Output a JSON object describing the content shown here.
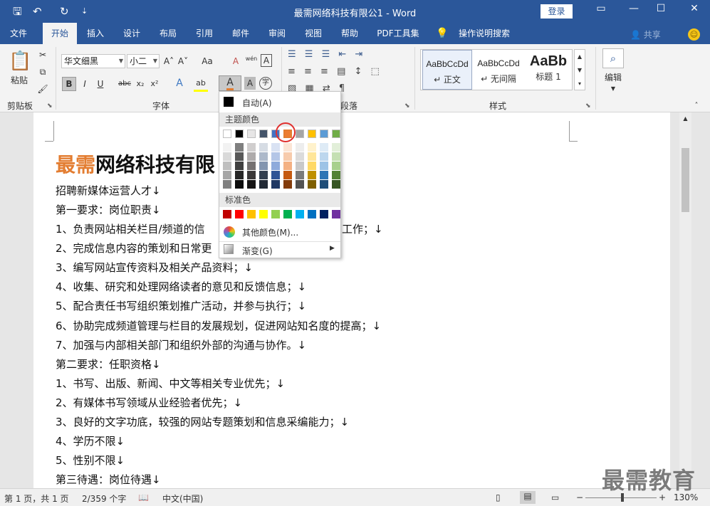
{
  "titlebar": {
    "title": "最需网络科技有限公1 - Word",
    "login": "登录",
    "qat": {
      "save": "🖫",
      "undo": "↶",
      "redo": "↻",
      "more": "⇣"
    },
    "controls": {
      "ribbon": "▭",
      "minimize": "—",
      "maximize": "☐",
      "close": "✕"
    }
  },
  "tabs": [
    "文件",
    "开始",
    "插入",
    "设计",
    "布局",
    "引用",
    "邮件",
    "审阅",
    "视图",
    "帮助",
    "PDF工具集",
    "操作说明搜索"
  ],
  "share": "共享",
  "ribbon": {
    "clipboard": {
      "paste": "粘贴",
      "label": "剪贴板"
    },
    "font": {
      "name": "华文细黑",
      "size": "小二",
      "label": "字体",
      "bold": "B",
      "italic": "I",
      "underline": "U",
      "strike": "abc",
      "sub": "x₂",
      "sup": "x²",
      "grow": "A˄",
      "shrink": "A˅",
      "case": "Aa",
      "clear": "A",
      "phonetic": "wén",
      "border": "A",
      "effect": "A",
      "highlight": "ab",
      "color": "A",
      "shade": "A",
      "circle": "字"
    },
    "paragraph": {
      "label": "段落"
    },
    "styles": {
      "label": "样式",
      "items": [
        {
          "sample": "AaBbCcDd",
          "name": "↵ 正文"
        },
        {
          "sample": "AaBbCcDd",
          "name": "↵ 无间隔"
        },
        {
          "sample": "AaBb",
          "name": "标题 1"
        }
      ]
    },
    "editing": {
      "label": "编辑"
    }
  },
  "document": {
    "title_accent": "最需",
    "title_rest": "网络科技有限",
    "lines": [
      "招聘新媒体运营人才↓",
      "第一要求：岗位职责↓",
      "1、负责网站相关栏目/频道的信",
      "2、完成信息内容的策划和日常更",
      "3、编写网站宣传资料及相关产品资料；↓",
      "4、收集、研究和处理网络读者的意见和反馈信息；↓",
      "5、配合责任书写组织策划推广活动，并参与执行；↓",
      "6、协助完成频道管理与栏目的发展规划，促进网站知名度的提高；↓",
      "7、加强与内部相关部门和组织外部的沟通与协作。↓",
      "第二要求：任职资格↓",
      "1、书写、出版、新闻、中文等相关专业优先；↓",
      "2、有媒体书写领域从业经验者优先；↓",
      "3、良好的文字功底，较强的网站专题策划和信息采编能力；↓",
      "4、学历不限↓",
      "5、性别不限↓",
      "第三待遇：岗位待遇↓"
    ],
    "line1_tail": "工作；↓"
  },
  "font_color_menu": {
    "auto": "自动(A)",
    "theme_label": "主题颜色",
    "standard_label": "标准色",
    "more": "其他颜色(M)...",
    "gradient": "渐变(G)",
    "theme_top": [
      "#ffffff",
      "#000000",
      "#e7e6e6",
      "#44546a",
      "#4472c4",
      "#ed7d31",
      "#a5a5a5",
      "#ffc000",
      "#5b9bd5",
      "#70ad47"
    ],
    "theme_shades": [
      [
        "#f2f2f2",
        "#d9d9d9",
        "#bfbfbf",
        "#a6a6a6",
        "#808080"
      ],
      [
        "#7f7f7f",
        "#595959",
        "#404040",
        "#262626",
        "#0d0d0d"
      ],
      [
        "#d0cece",
        "#aeabab",
        "#757171",
        "#3a3838",
        "#171616"
      ],
      [
        "#d6dce4",
        "#adb9ca",
        "#8496b0",
        "#333f4f",
        "#222a35"
      ],
      [
        "#d9e2f3",
        "#b4c6e7",
        "#8eaadb",
        "#2f5496",
        "#1f3864"
      ],
      [
        "#fbe5d5",
        "#f7cbac",
        "#f4b183",
        "#c55a11",
        "#833c0b"
      ],
      [
        "#ededed",
        "#dbdbdb",
        "#c9c9c9",
        "#7b7b7b",
        "#525252"
      ],
      [
        "#fff2cc",
        "#ffe699",
        "#ffd965",
        "#bf9000",
        "#7f6000"
      ],
      [
        "#deebf6",
        "#bdd7ee",
        "#9dc3e6",
        "#2e75b5",
        "#1f4e79"
      ],
      [
        "#e2efd9",
        "#c5e0b3",
        "#a8d08d",
        "#538135",
        "#375623"
      ]
    ],
    "standard": [
      "#c00000",
      "#ff0000",
      "#ffc000",
      "#ffff00",
      "#92d050",
      "#00b050",
      "#00b0f0",
      "#0070c0",
      "#002060",
      "#7030a0"
    ]
  },
  "status": {
    "page": "第 1 页，共 1 页",
    "words": "2/359 个字",
    "lang": "中文(中国)",
    "zoom": "130%",
    "minus": "−",
    "plus": "+"
  },
  "watermark": "最需教育"
}
